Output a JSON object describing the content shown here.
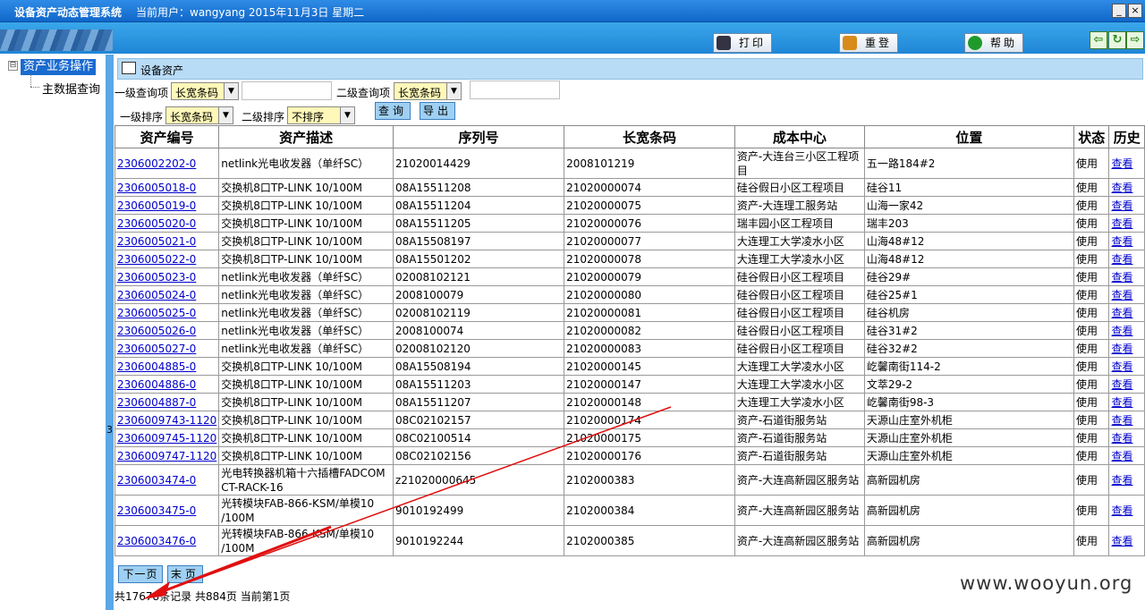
{
  "titlebar": {
    "app_name": "设备资产动态管理系统",
    "current_user": "当前用户：wangyang 2015年11月3日 星期二",
    "minimize": "_",
    "close": "×"
  },
  "toolbar": {
    "print_label": "打印",
    "relogin_label": "重登",
    "help_label": "帮助",
    "back_icon": "⇦",
    "refresh_icon": "↻",
    "forward_icon": "⇨"
  },
  "tree": {
    "toggle": "⊟",
    "root": "资产业务操作",
    "child": "主数据查询"
  },
  "splitter_label": "3",
  "section_title": "设备资产",
  "filters": {
    "level1_query_label": "一级查询项",
    "level1_query_value": "长宽条码",
    "level1_query_text": "",
    "level2_query_label": "二级查询项",
    "level2_query_value": "长宽条码",
    "level2_query_text": "",
    "level1_sort_label": "一级排序",
    "level1_sort_value": "长宽条码",
    "level2_sort_label": "二级排序",
    "level2_sort_value": "不排序",
    "query_button": "查询",
    "export_button": "导出",
    "dropdown_arrow": "▼"
  },
  "table": {
    "headers": [
      "资产编号",
      "资产描述",
      "序列号",
      "长宽条码",
      "成本中心",
      "位置",
      "状态",
      "历史"
    ],
    "rows": [
      [
        "2306002202-0",
        "netlink光电收发器（单纤SC）",
        "21020014429",
        "2008101219",
        "资产-大连台三小区工程项目",
        "五一路184#2",
        "使用",
        "查看"
      ],
      [
        "2306005018-0",
        "交换机8口TP-LINK 10/100M",
        "08A15511208",
        "21020000074",
        "硅谷假日小区工程项目",
        "硅谷11",
        "使用",
        "查看"
      ],
      [
        "2306005019-0",
        "交换机8口TP-LINK 10/100M",
        "08A15511204",
        "21020000075",
        "资产-大连理工服务站",
        "山海一家42",
        "使用",
        "查看"
      ],
      [
        "2306005020-0",
        "交换机8口TP-LINK 10/100M",
        "08A15511205",
        "21020000076",
        "瑞丰园小区工程项目",
        "瑞丰203",
        "使用",
        "查看"
      ],
      [
        "2306005021-0",
        "交换机8口TP-LINK 10/100M",
        "08A15508197",
        "21020000077",
        "大连理工大学凌水小区",
        "山海48#12",
        "使用",
        "查看"
      ],
      [
        "2306005022-0",
        "交换机8口TP-LINK 10/100M",
        "08A15501202",
        "21020000078",
        "大连理工大学凌水小区",
        "山海48#12",
        "使用",
        "查看"
      ],
      [
        "2306005023-0",
        "netlink光电收发器（单纤SC）",
        "02008102121",
        "21020000079",
        "硅谷假日小区工程项目",
        "硅谷29#",
        "使用",
        "查看"
      ],
      [
        "2306005024-0",
        "netlink光电收发器（单纤SC）",
        "2008100079",
        "21020000080",
        "硅谷假日小区工程项目",
        "硅谷25#1",
        "使用",
        "查看"
      ],
      [
        "2306005025-0",
        "netlink光电收发器（单纤SC）",
        "02008102119",
        "21020000081",
        "硅谷假日小区工程项目",
        "硅谷机房",
        "使用",
        "查看"
      ],
      [
        "2306005026-0",
        "netlink光电收发器（单纤SC）",
        "2008100074",
        "21020000082",
        "硅谷假日小区工程项目",
        "硅谷31#2",
        "使用",
        "查看"
      ],
      [
        "2306005027-0",
        "netlink光电收发器（单纤SC）",
        "02008102120",
        "21020000083",
        "硅谷假日小区工程项目",
        "硅谷32#2",
        "使用",
        "查看"
      ],
      [
        "2306004885-0",
        "交换机8口TP-LINK 10/100M",
        "08A15508194",
        "21020000145",
        "大连理工大学凌水小区",
        "屹馨南街114-2",
        "使用",
        "查看"
      ],
      [
        "2306004886-0",
        "交换机8口TP-LINK 10/100M",
        "08A15511203",
        "21020000147",
        "大连理工大学凌水小区",
        "文萃29-2",
        "使用",
        "查看"
      ],
      [
        "2306004887-0",
        "交换机8口TP-LINK 10/100M",
        "08A15511207",
        "21020000148",
        "大连理工大学凌水小区",
        "屹馨南街98-3",
        "使用",
        "查看"
      ],
      [
        "2306009743-1120",
        "交换机8口TP-LINK 10/100M",
        "08C02102157",
        "21020000174",
        "资产-石道街服务站",
        "天源山庄室外机柜",
        "使用",
        "查看"
      ],
      [
        "2306009745-1120",
        "交换机8口TP-LINK 10/100M",
        "08C02100514",
        "21020000175",
        "资产-石道街服务站",
        "天源山庄室外机柜",
        "使用",
        "查看"
      ],
      [
        "2306009747-1120",
        "交换机8口TP-LINK 10/100M",
        "08C02102156",
        "21020000176",
        "资产-石道街服务站",
        "天源山庄室外机柜",
        "使用",
        "查看"
      ],
      [
        "2306003474-0",
        "光电转换器机箱十六插槽FADCOM CT-RACK-16",
        "z21020000645",
        "2102000383",
        "资产-大连高新园区服务站",
        "高新园机房",
        "使用",
        "查看"
      ],
      [
        "2306003475-0",
        "光转模块FAB-866-KSM/单模10 /100M",
        "9010192499",
        "2102000384",
        "资产-大连高新园区服务站",
        "高新园机房",
        "使用",
        "查看"
      ],
      [
        "2306003476-0",
        "光转模块FAB-866-KSM/单模10 /100M",
        "9010192244",
        "2102000385",
        "资产-大连高新园区服务站",
        "高新园机房",
        "使用",
        "查看"
      ]
    ]
  },
  "pager": {
    "next_label": "下一页",
    "last_label": "末页",
    "info": "共17678条记录 共884页 当前第1页"
  },
  "watermark": "www.wooyun.org",
  "colors": {
    "title_bar": "#1a74d6",
    "toolbar": "#2b92df",
    "header_strip": "#b9dcf6",
    "dropdown_bg": "#fff8b8",
    "link": "#0000cc",
    "annotation_arrow": "#e01010"
  }
}
